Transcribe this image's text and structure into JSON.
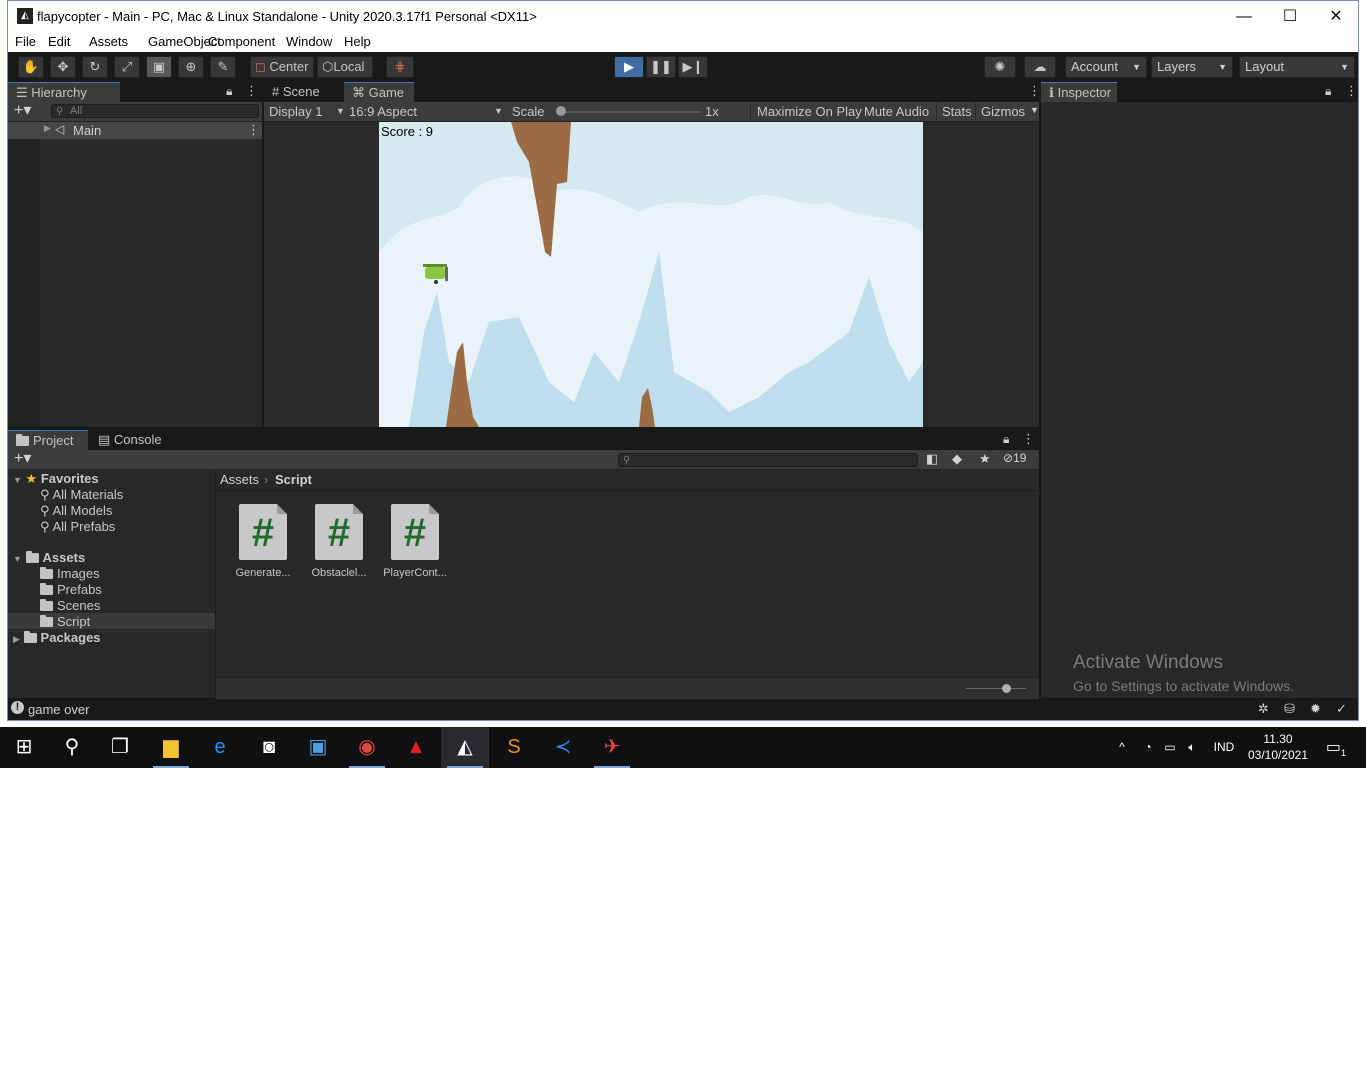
{
  "window": {
    "title": "flapycopter - Main - PC, Mac & Linux Standalone - Unity 2020.3.17f1 Personal <DX11>",
    "controls": {
      "minimize": "—",
      "maximize": "☐",
      "close": "✕"
    }
  },
  "menu": [
    "File",
    "Edit",
    "Assets",
    "GameObject",
    "Component",
    "Window",
    "Help"
  ],
  "toolbar": {
    "tools": [
      "hand",
      "move",
      "rotate",
      "scale",
      "rect",
      "transform",
      "custom"
    ],
    "pivot": "Center",
    "space": "Local",
    "account": "Account",
    "layers": "Layers",
    "layout": "Layout",
    "play_state": "playing"
  },
  "hierarchy": {
    "tab": "Hierarchy",
    "search_placeholder": "All",
    "items": [
      "Main"
    ]
  },
  "scene_tab": "Scene",
  "game": {
    "tab": "Game",
    "display": "Display 1",
    "aspect": "16:9 Aspect",
    "scale_label": "Scale",
    "scale_value": "1x",
    "scale_fraction": 0,
    "maximize": "Maximize On Play",
    "mute": "Mute Audio",
    "stats": "Stats",
    "gizmos": "Gizmos",
    "score": "Score : 9",
    "colors": {
      "sky": "#d4e9f2",
      "rock": "#9b6b43",
      "cloud": "#eaf4f8",
      "copter": "#8cc63f"
    }
  },
  "inspector": {
    "tab": "Inspector"
  },
  "project": {
    "tab": "Project",
    "console_tab": "Console",
    "hidden_count": "19",
    "favorites": {
      "label": "Favorites",
      "items": [
        "All Materials",
        "All Models",
        "All Prefabs"
      ]
    },
    "assets": {
      "label": "Assets",
      "folders": [
        "Images",
        "Prefabs",
        "Scenes",
        "Script"
      ],
      "selected": "Script"
    },
    "packages": "Packages",
    "breadcrumb": [
      "Assets",
      "Script"
    ],
    "files": [
      "Generate...",
      "Obstaclel...",
      "PlayerCont..."
    ]
  },
  "status": {
    "message": "game over"
  },
  "watermark": {
    "title": "Activate Windows",
    "subtitle": "Go to Settings to activate Windows."
  },
  "taskbar": {
    "apps": [
      "file-explorer",
      "edge",
      "camera",
      "media-player",
      "chrome",
      "acrobat",
      "unity",
      "sublime-text",
      "vscode",
      "unity-hub"
    ],
    "language": "IND",
    "time": "11.30",
    "date": "03/10/2021",
    "notifications": "1"
  }
}
